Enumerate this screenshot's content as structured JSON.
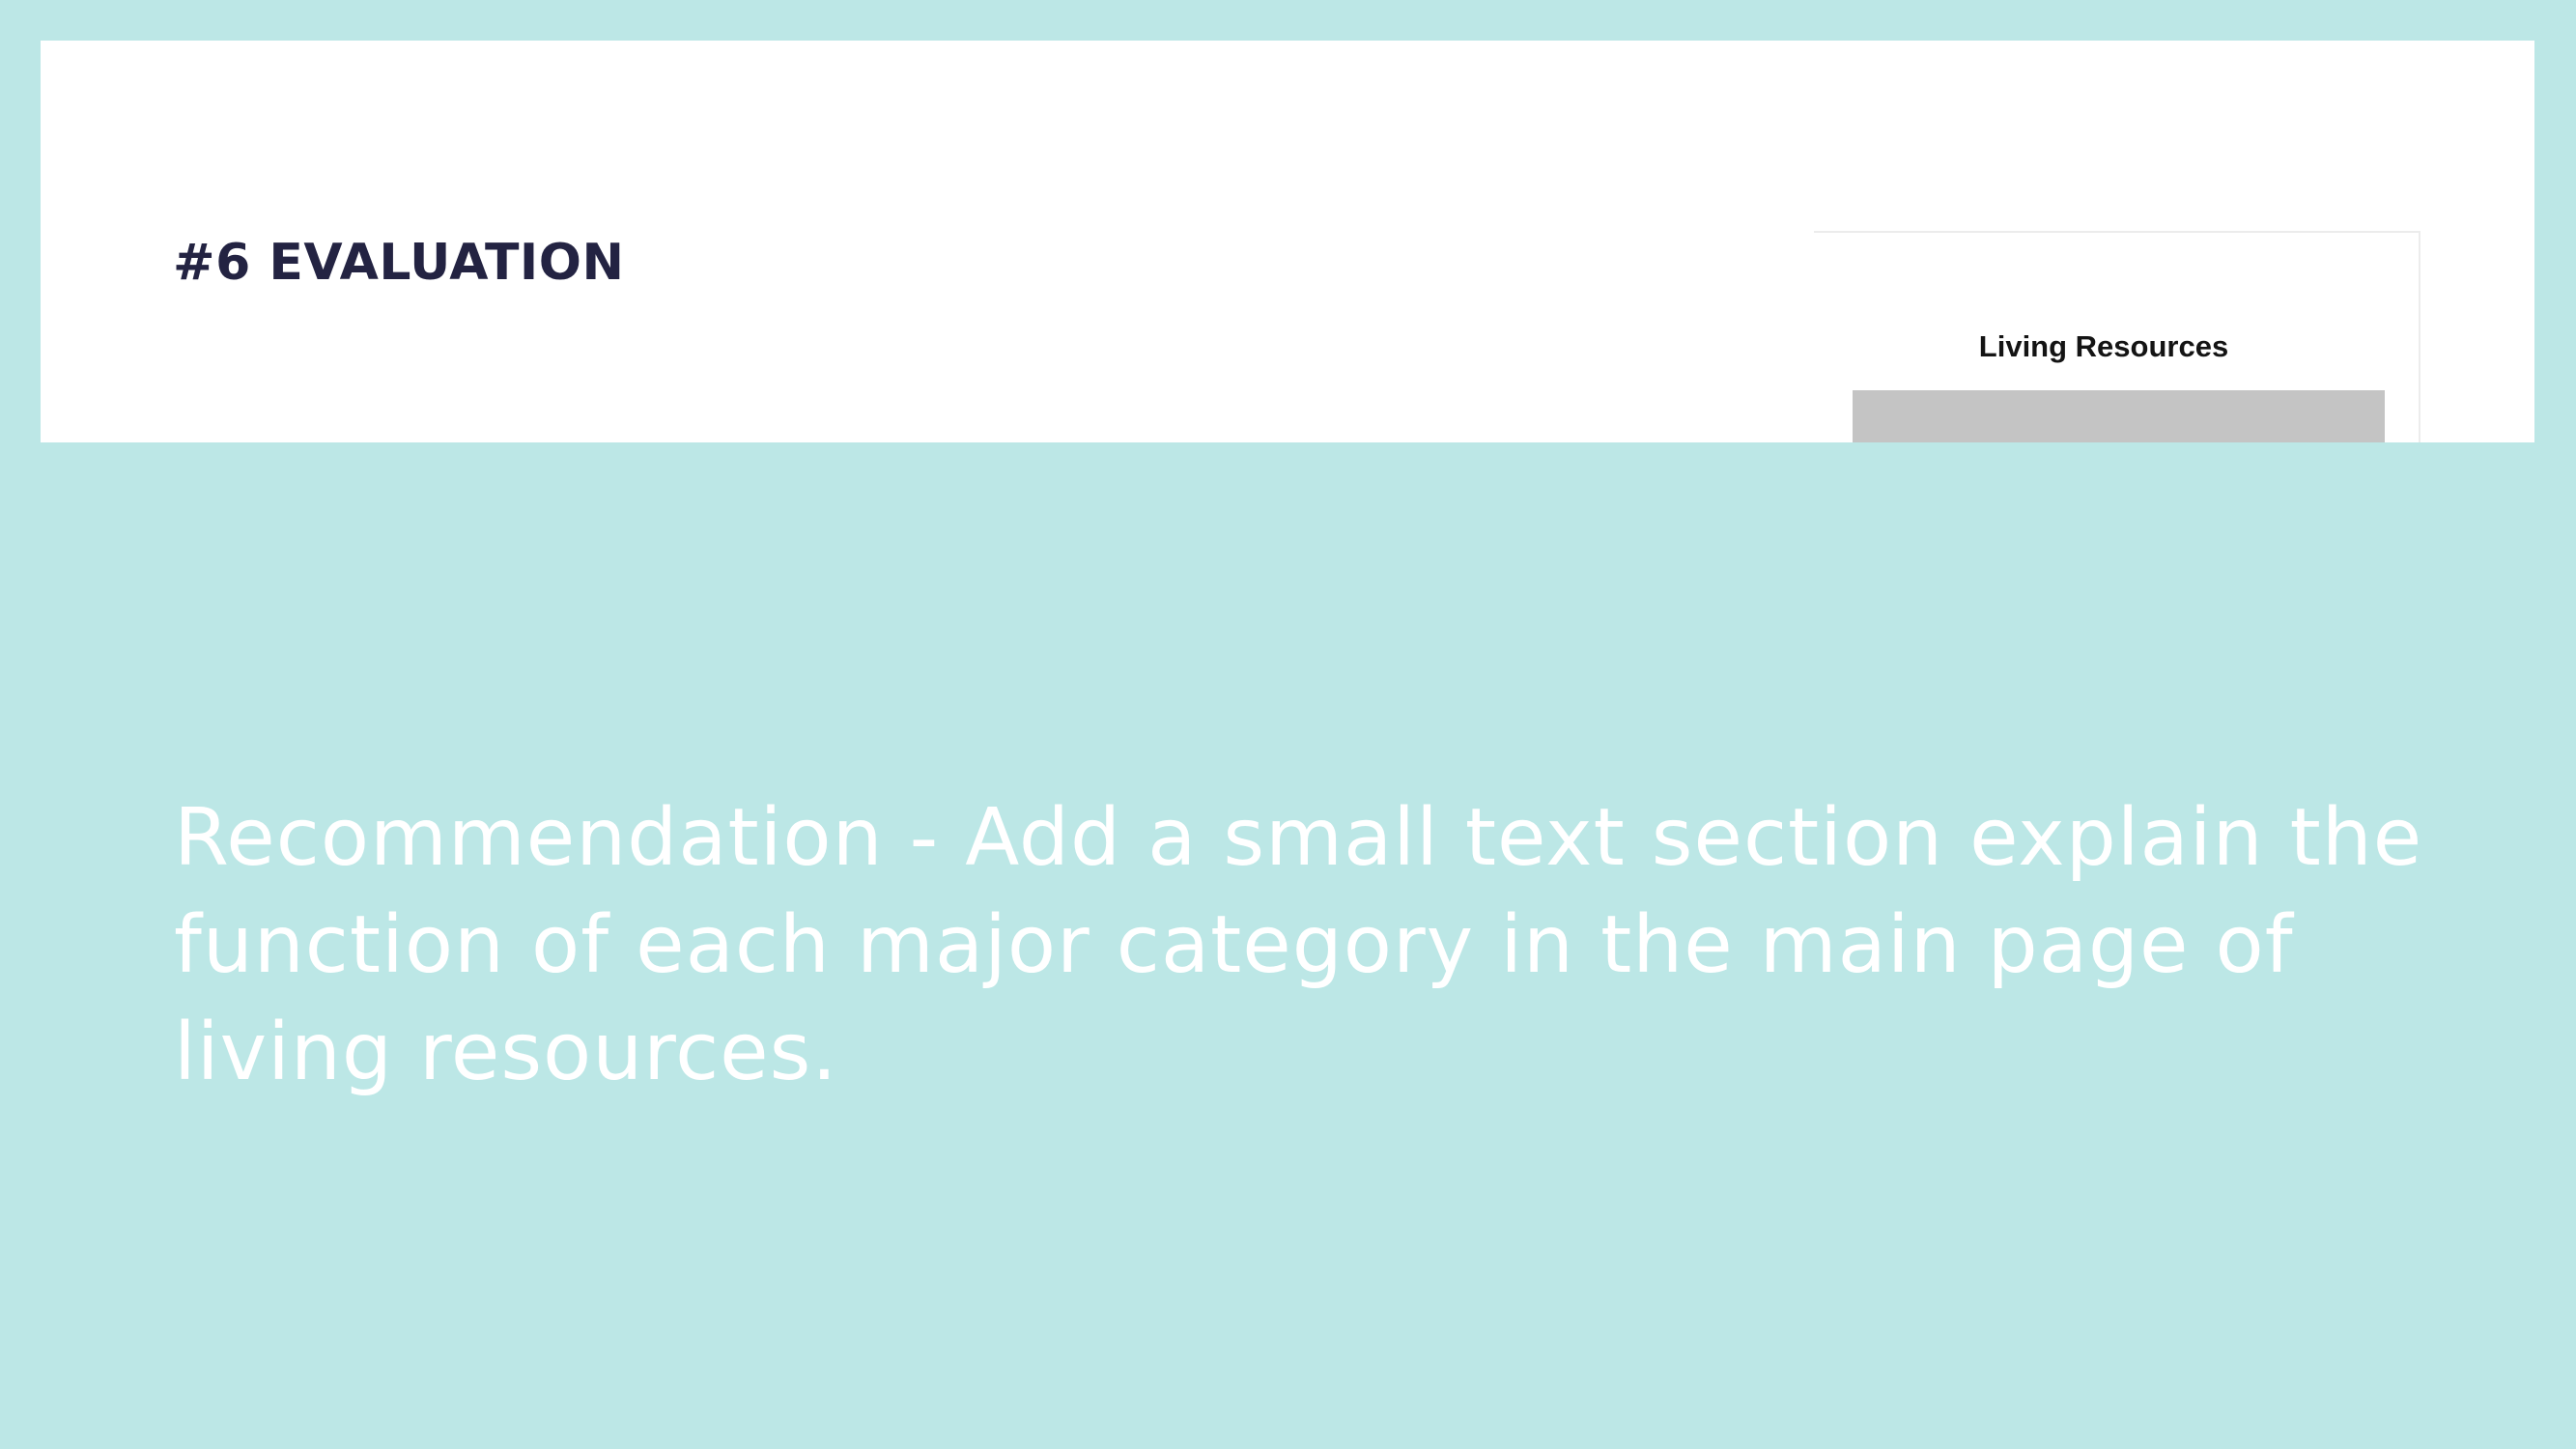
{
  "slide": {
    "title": "#6 EVALUATION",
    "recommendation": "Recommendation - Add a small text section explain the function of each major category in the main page of living resources."
  },
  "screenshot": {
    "card_title": "Living Resources"
  },
  "colors": {
    "background": "#bce7e6",
    "panel": "#ffffff",
    "title": "#232342",
    "recommendation_text": "#ffffff",
    "image_placeholder": "#c4c4c4"
  }
}
